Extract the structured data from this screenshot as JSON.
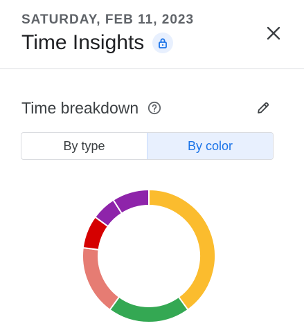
{
  "header": {
    "date": "SATURDAY, FEB 11, 2023",
    "title": "Time Insights",
    "lock_icon": "lock-icon",
    "close_icon": "close-icon"
  },
  "section": {
    "title": "Time breakdown",
    "help_icon": "help-circle-icon",
    "edit_icon": "pencil-icon"
  },
  "toggle": {
    "options": [
      "By type",
      "By color"
    ],
    "selected": "By color"
  },
  "chart_data": {
    "type": "pie",
    "title": "",
    "categories": [
      "",
      "",
      "",
      "",
      "",
      ""
    ],
    "values": [
      40,
      20,
      17,
      8,
      6,
      9
    ],
    "colors": [
      "#fbbc2e",
      "#34a853",
      "#e67c73",
      "#d50000",
      "#8e24aa",
      "#8e24aa"
    ],
    "donut": true
  }
}
